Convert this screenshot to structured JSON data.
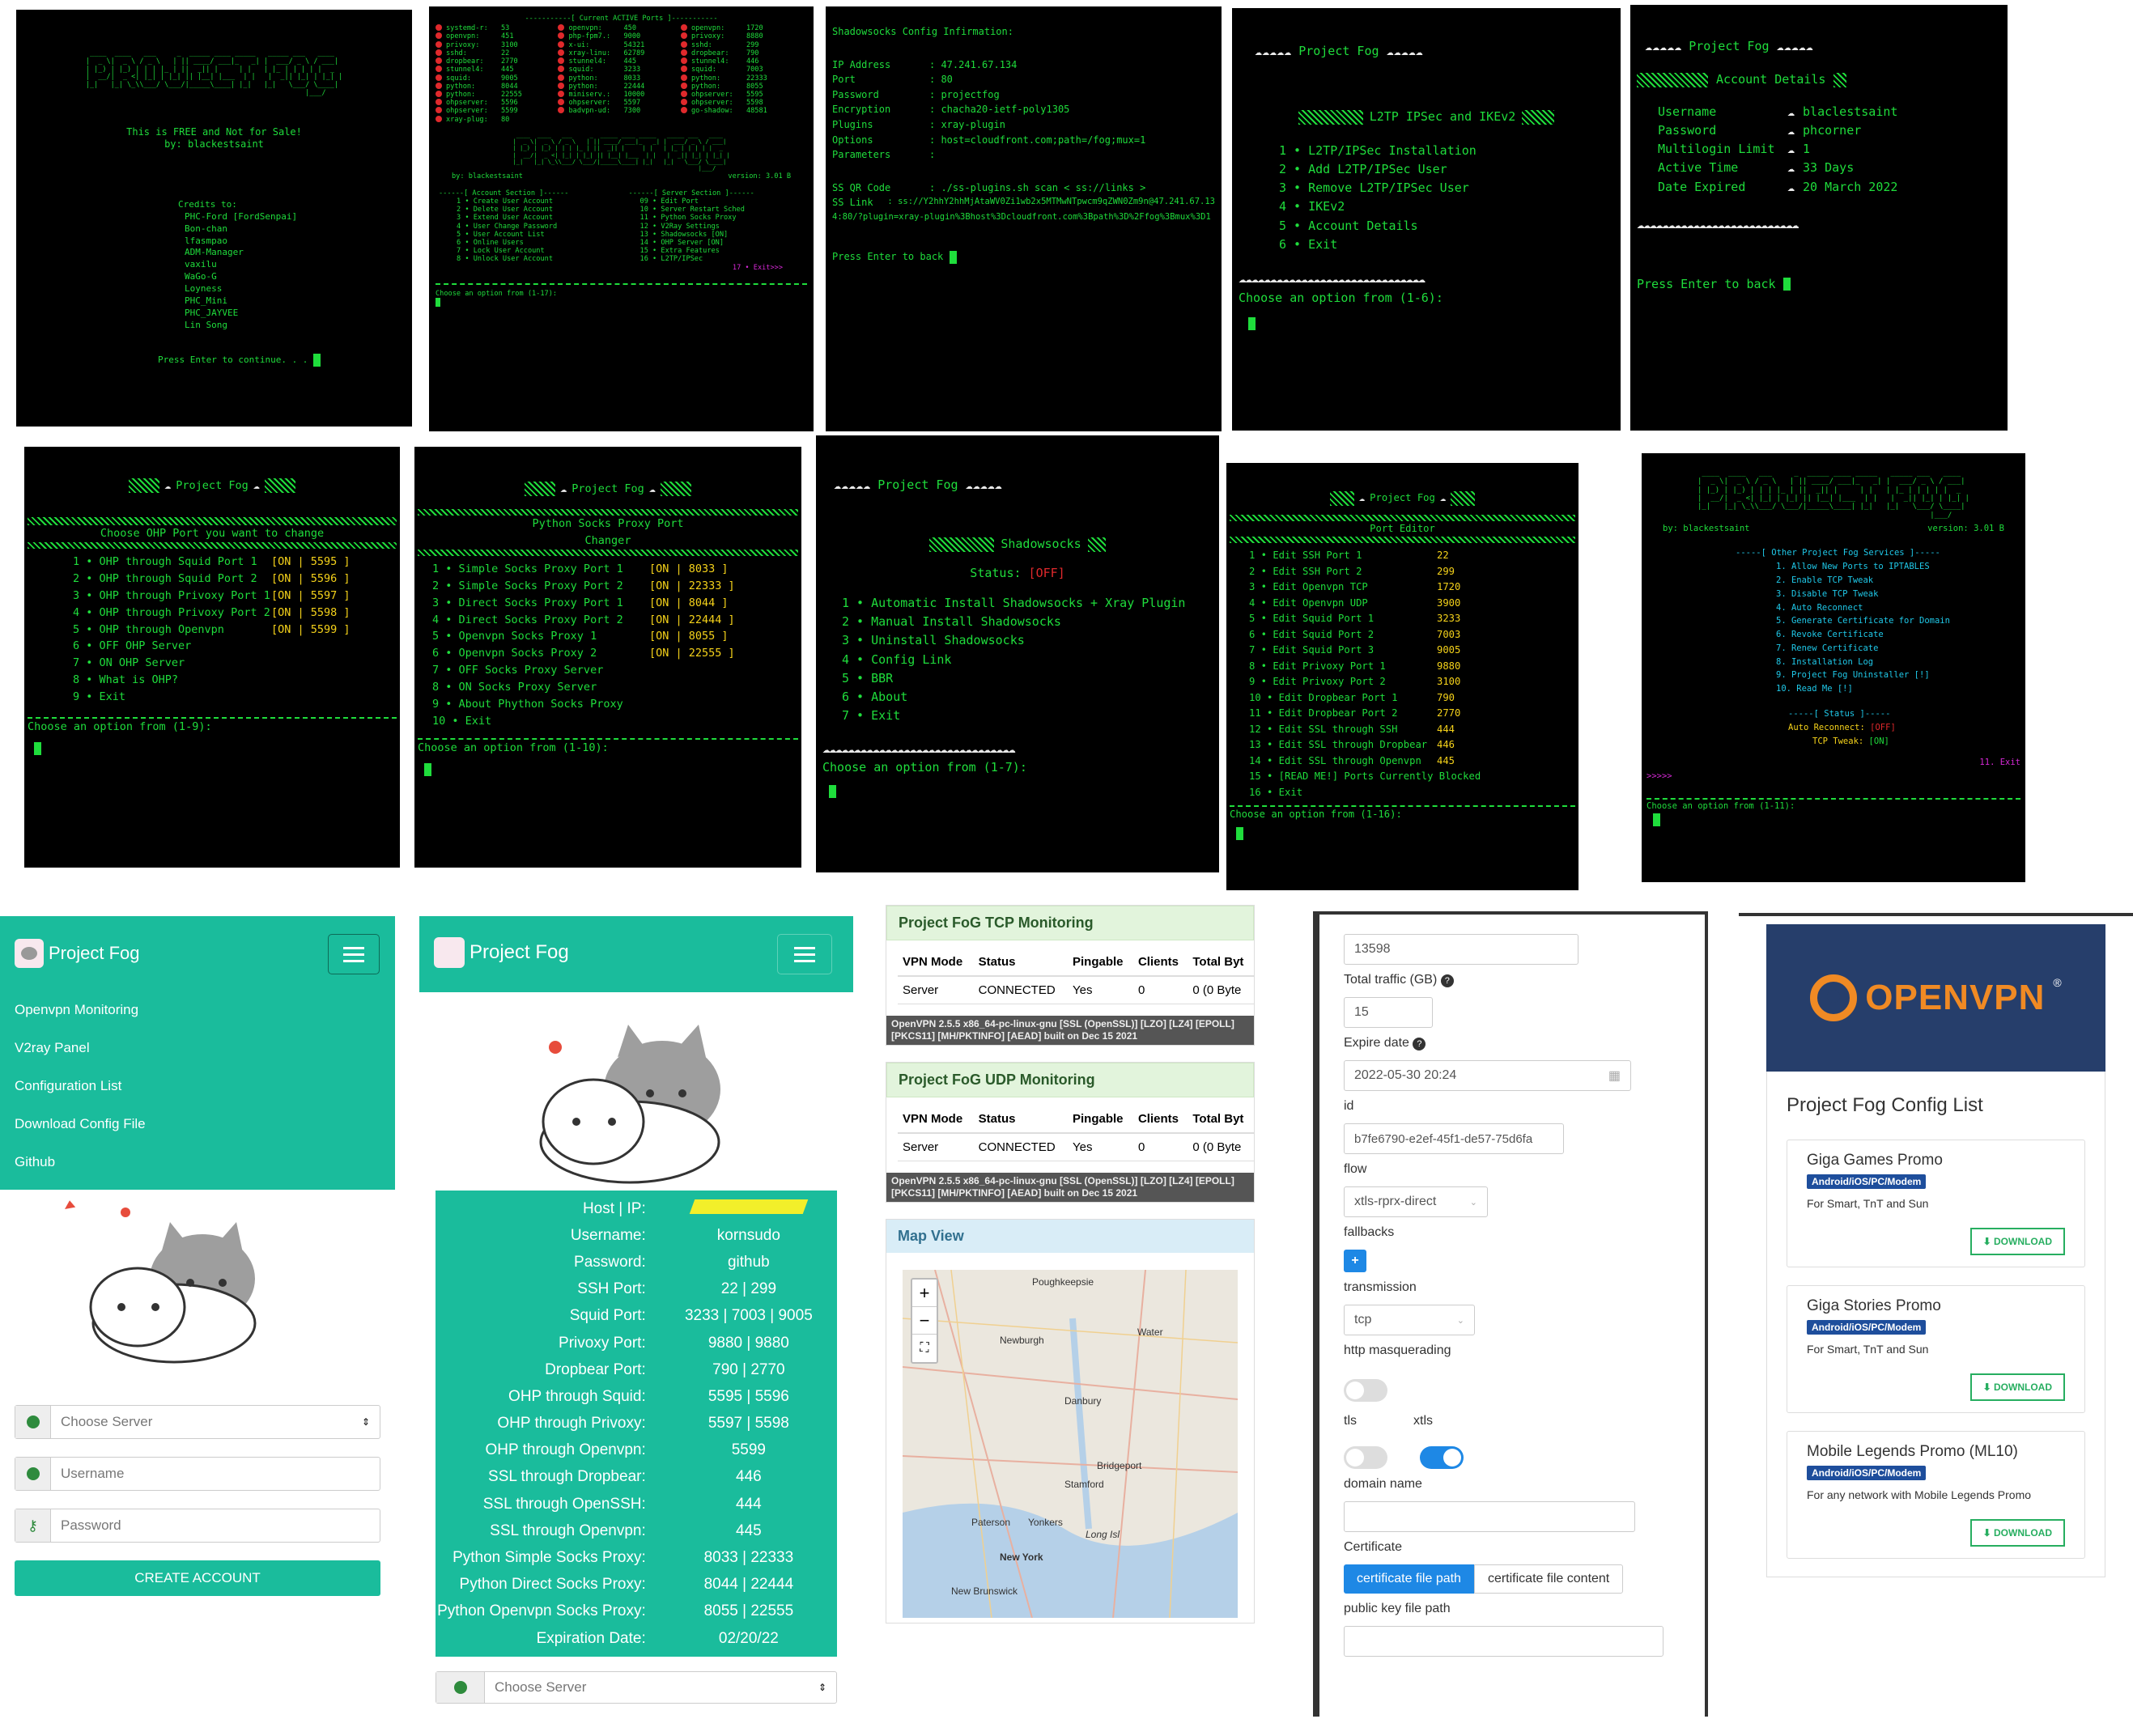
{
  "t1": {
    "ascii": " ____  ____   ___     _  _____ ____ _____   _____ ___   ____ \n|  _ \\|  _ \\ / _ \\   | || ____/ ___|_   _| |  ___/ _ \\ / ___|\n| |_) | |_) | | | |_ | ||  _|| |     | |   | |_ | | | | |  _ \n|  __/|  _ <| |_| | |_| || |__| |___  | |   |  _|| |_| | |_| |\n|_|   |_| \\_\\\\___/ \\___/|_____\\____| |_|   |_|   \\___/ \\____|\n                                                     |___/ ",
    "free": "This is FREE and Not for Sale!",
    "by": "by: blackestsaint",
    "credits": "Credits to:",
    "names": [
      "PHC-Ford [FordSenpai]",
      "Bon-chan",
      "lfasmpao",
      "ADM-Manager",
      "vaxilu",
      "WaGo-G",
      "Loyness",
      "PHC_Mini",
      "PHC_JAYVEE",
      "Lin Song"
    ],
    "press": "Press Enter to continue. . ."
  },
  "t2": {
    "title": "-----------[ Current ACTIVE Ports ]-----------",
    "ports": [
      [
        "systemd-r:",
        "53",
        "openvpn:",
        "450",
        "openvpn:",
        "1720"
      ],
      [
        "openvpn:",
        "451",
        "php-fpm7.:",
        "9000",
        "privoxy:",
        "8880"
      ],
      [
        "privoxy:",
        "3100",
        "x-ui:",
        "54321",
        "sshd:",
        "299"
      ],
      [
        "sshd:",
        "22",
        "xray-linu:",
        "62789",
        "dropbear:",
        "790"
      ],
      [
        "dropbear:",
        "2770",
        "stunnel4:",
        "445",
        "stunnel4:",
        "446"
      ],
      [
        "stunnel4:",
        "445",
        "squid:",
        "3233",
        "squid:",
        "7003"
      ],
      [
        "squid:",
        "9005",
        "python:",
        "8033",
        "python:",
        "22333"
      ],
      [
        "python:",
        "8044",
        "python:",
        "22444",
        "python:",
        "8055"
      ],
      [
        "python:",
        "22555",
        "miniserv.:",
        "10000",
        "ohpserver:",
        "5595"
      ],
      [
        "ohpserver:",
        "5596",
        "ohpserver:",
        "5597",
        "ohpserver:",
        "5598"
      ],
      [
        "ohpserver:",
        "5599",
        "badvpn-ud:",
        "7300",
        "go-shadow:",
        "48581"
      ],
      [
        "xray-plug:",
        "80",
        "",
        "",
        "",
        ""
      ]
    ],
    "by": "by: blackestsaint",
    "ver": "version: 3.01 B",
    "acct": "------[ Account Section ]------",
    "srv": "------[ Server Section ]------",
    "left": [
      "1 • Create User Account",
      "2 • Delete User Account",
      "3 • Extend User Account",
      "4 • User Change Password",
      "5 • User Account List",
      "6 • Online Users",
      "7 • Lock User Account",
      "8 • Unlock User Account"
    ],
    "right": [
      "09 • Edit Port",
      "10 • Server Restart Sched",
      "11 • Python Socks Proxy",
      "12 • V2Ray Settings",
      "13 • Shadowsocks  [ON]",
      "14 • OHP Server   [ON]",
      "15 • Extra Features",
      "16 • L2TP/IPSec"
    ],
    "exit": "17 • Exit>>>",
    "choose": "Choose an option from (1-17):"
  },
  "t3": {
    "title": "Shadowsocks Config Infirmation:",
    "rows": [
      [
        "IP Address",
        ": 47.241.67.134"
      ],
      [
        "Port",
        ": 80"
      ],
      [
        "Password",
        ": projectfog"
      ],
      [
        "Encryption",
        ": chacha20-ietf-poly1305"
      ],
      [
        "Plugins",
        ": xray-plugin"
      ],
      [
        "Options",
        ": host=cloudfront.com;path=/fog;mux=1"
      ],
      [
        "Parameters",
        ":"
      ]
    ],
    "qr_l": "SS QR Code",
    "qr_v": ": ./ss-plugins.sh scan < ss://links >",
    "link_l": "SS Link",
    "link_v": ": ss://Y2hhY2hhMjAtaWV0Zi1wb2x5MTMwNTpwcm9qZWN0Zm9n@47.241.67.13",
    "link2": "4:80/?plugin=xray-plugin%3Bhost%3Dcloudfront.com%3Bpath%3D%2Ffog%3Bmux%3D1",
    "press": "Press Enter to back"
  },
  "t4": {
    "title": "Project Fog",
    "sub": "L2TP IPSec and IKEv2",
    "items": [
      "1 • L2TP/IPSec Installation",
      "2 • Add L2TP/IPSec User",
      "3 • Remove L2TP/IPSec User",
      "4 • IKEv2",
      "5 • Account Details",
      "6 • Exit"
    ],
    "choose": "Choose an option from (1-6):"
  },
  "t5": {
    "title": "Project Fog",
    "sub": "Account Details",
    "rows": [
      [
        "Username",
        "blaclestsaint"
      ],
      [
        "Password",
        "phcorner"
      ],
      [
        "Multilogin Limit",
        "1"
      ],
      [
        "Active Time",
        "33 Days"
      ],
      [
        "Date Expired",
        "20 March 2022"
      ]
    ],
    "press": "Press Enter to back"
  },
  "t6": {
    "title": "Project Fog",
    "sub": "Choose OHP Port you want to change",
    "items": [
      [
        "1 • OHP through Squid Port 1",
        "[ON | 5595 ]"
      ],
      [
        "2 • OHP through Squid Port 2",
        "[ON | 5596 ]"
      ],
      [
        "3 • OHP through Privoxy Port 1",
        "[ON | 5597 ]"
      ],
      [
        "4 • OHP through Privoxy Port 2",
        "[ON | 5598 ]"
      ],
      [
        "5 • OHP through Openvpn",
        "[ON | 5599 ]"
      ],
      [
        "6 • OFF OHP Server",
        ""
      ],
      [
        "7 • ON OHP Server",
        ""
      ],
      [
        "8 • What is OHP?",
        ""
      ],
      [
        "9 • Exit",
        ""
      ]
    ],
    "choose": "Choose an option from (1-9):"
  },
  "t7": {
    "title": "Project Fog",
    "sub1": "Python Socks Proxy Port",
    "sub2": "Changer",
    "items": [
      [
        "1 • Simple Socks Proxy Port 1",
        "[ON | 8033 ]"
      ],
      [
        "2 • Simple Socks Proxy Port 2",
        "[ON | 22333 ]"
      ],
      [
        "3 • Direct Socks Proxy Port 1",
        "[ON | 8044 ]"
      ],
      [
        "4 • Direct Socks Proxy Port 2",
        "[ON | 22444 ]"
      ],
      [
        "5 • Openvpn Socks Proxy 1",
        "[ON | 8055 ]"
      ],
      [
        "6 • Openvpn Socks Proxy 2",
        "[ON | 22555 ]"
      ],
      [
        "7 • OFF Socks Proxy Server",
        ""
      ],
      [
        "8 • ON  Socks Proxy Server",
        ""
      ],
      [
        "9 • About Phython Socks Proxy",
        ""
      ],
      [
        "10 • Exit",
        ""
      ]
    ],
    "choose": "Choose an option from (1-10):"
  },
  "t8": {
    "title": "Project Fog",
    "sub": "Shadowsocks",
    "status_l": "Status:",
    "status_v": "[OFF]",
    "items": [
      "1 • Automatic Install Shadowsocks + Xray Plugin",
      "2 • Manual Install Shadowsocks",
      "3 • Uninstall Shadowsocks",
      "4 • Config Link",
      "5 • BBR",
      "6 • About",
      "7 • Exit"
    ],
    "choose": "Choose an option from (1-7):"
  },
  "t9": {
    "title": "Project Fog",
    "sub": "Port Editor",
    "items": [
      [
        "1 • Edit SSH Port 1",
        "22"
      ],
      [
        "2 • Edit SSH Port 2",
        "299"
      ],
      [
        "3 • Edit Openvpn TCP",
        "1720"
      ],
      [
        "4 • Edit Openvpn UDP",
        "3900"
      ],
      [
        "5 • Edit Squid Port 1",
        "3233"
      ],
      [
        "6 • Edit Squid Port 2",
        "7003"
      ],
      [
        "7 • Edit Squid Port 3",
        "9005"
      ],
      [
        "8 • Edit Privoxy Port 1",
        "9880"
      ],
      [
        "9 • Edit Privoxy Port 2",
        "3100"
      ],
      [
        "10 • Edit Dropbear Port 1",
        "790"
      ],
      [
        "11 • Edit Dropbear Port 2",
        "2770"
      ],
      [
        "12 • Edit SSL through SSH",
        "444"
      ],
      [
        "13 • Edit SSL through Dropbear",
        "446"
      ],
      [
        "14 • Edit SSL through Openvpn",
        "445"
      ],
      [
        "15 • [READ ME!] Ports Currently Blocked",
        ""
      ],
      [
        "16 • Exit",
        ""
      ]
    ],
    "choose": "Choose an option from (1-16):"
  },
  "t10": {
    "by": "by: blackestsaint",
    "ver": "version: 3.01 B",
    "head": "-----[ Other Project Fog Services ]-----",
    "items": [
      "1. Allow New Ports to IPTABLES",
      "2. Enable  TCP Tweak",
      "3. Disable TCP Tweak",
      "4. Auto Reconnect",
      "5. Generate Certificate for Domain",
      "6. Revoke Certificate",
      "7. Renew Certificate",
      "8. Installation Log",
      "9. Project Fog Uninstaller [!]",
      "10. Read Me [!]"
    ],
    "status": "-----[ Status ]-----",
    "ar_l": "Auto Reconnect:",
    "ar_v": "[OFF]",
    "tcp_l": "TCP Tweak:",
    "tcp_v": "[ON]",
    "exit": "11. Exit",
    "arrows": ">>>>>",
    "choose": "Choose an option from (1-11):"
  },
  "w1": {
    "brand": "Project Fog",
    "nav": [
      "Openvpn Monitoring",
      "V2ray Panel",
      "Configuration List",
      "Download Config File",
      "Github"
    ],
    "server": "Choose Server",
    "user": "Username",
    "pass": "Password",
    "create": "CREATE ACCOUNT"
  },
  "w2": {
    "brand": "Project Fog",
    "rows": [
      [
        "Host | IP:",
        ""
      ],
      [
        "Username:",
        "kornsudo"
      ],
      [
        "Password:",
        "github"
      ],
      [
        "SSH Port:",
        "22 | 299"
      ],
      [
        "Squid Port:",
        "3233 | 7003 | 9005"
      ],
      [
        "Privoxy Port:",
        "9880 | 9880"
      ],
      [
        "Dropbear Port:",
        "790 | 2770"
      ],
      [
        "OHP through Squid:",
        "5595 | 5596"
      ],
      [
        "OHP through Privoxy:",
        "5597 | 5598"
      ],
      [
        "OHP through Openvpn:",
        "5599"
      ],
      [
        "SSL through Dropbear:",
        "446"
      ],
      [
        "SSL through OpenSSH:",
        "444"
      ],
      [
        "SSL through Openvpn:",
        "445"
      ],
      [
        "Python Simple Socks Proxy:",
        "8033 | 22333"
      ],
      [
        "Python Direct Socks Proxy:",
        "8044 | 22444"
      ],
      [
        "Python Openvpn Socks Proxy:",
        "8055 | 22555"
      ],
      [
        "Expiration Date:",
        "02/20/22"
      ]
    ],
    "server": "Choose Server"
  },
  "w3": {
    "tcp": "Project FoG TCP Monitoring",
    "udp": "Project FoG UDP Monitoring",
    "cols": [
      "VPN Mode",
      "Status",
      "Pingable",
      "Clients",
      "Total Byt"
    ],
    "row": [
      "Server",
      "CONNECTED",
      "Yes",
      "0",
      "0 (0 Byte"
    ],
    "foot": "OpenVPN 2.5.5 x86_64-pc-linux-gnu [SSL (OpenSSL)] [LZO] [LZ4] [EPOLL] [PKCS11] [MH/PKTINFO] [AEAD] built on Dec 15 2021",
    "map": "Map View",
    "places": [
      "Poughkeepsie",
      "Newburgh",
      "Danbury",
      "Bridgeport",
      "Stamford",
      "Paterson",
      "Yonkers",
      "New York",
      "Long Isl",
      "New Brunswick",
      "Water"
    ]
  },
  "w4": {
    "top": "13598",
    "traffic": "Total traffic (GB)",
    "traffic_v": "15",
    "expire": "Expire date",
    "expire_v": "2022-05-30 20:24",
    "id": "id",
    "id_v": "b7fe6790-e2ef-45f1-de57-75d6fa",
    "flow": "flow",
    "flow_v": "xtls-rprx-direct",
    "fallbacks": "fallbacks",
    "plus": "+",
    "transmission": "transmission",
    "trans_v": "tcp",
    "http": "http masquerading",
    "tls": "tls",
    "xtls": "xtls",
    "domain": "domain name",
    "cert": "Certificate",
    "cert_a": "certificate file path",
    "cert_b": "certificate file content",
    "pub": "public key file path"
  },
  "w5": {
    "logo": "OPENVPN",
    "title": "Project Fog Config List",
    "cards": [
      {
        "name": "Giga Games Promo",
        "badge": "Android/iOS/PC/Modem",
        "desc": "For Smart, TnT and Sun"
      },
      {
        "name": "Giga Stories Promo",
        "badge": "Android/iOS/PC/Modem",
        "desc": "For Smart, TnT and Sun"
      },
      {
        "name": "Mobile Legends Promo (ML10)",
        "badge": "Android/iOS/PC/Modem",
        "desc": "For any network with Mobile Legends Promo"
      }
    ],
    "download": "DOWNLOAD"
  }
}
